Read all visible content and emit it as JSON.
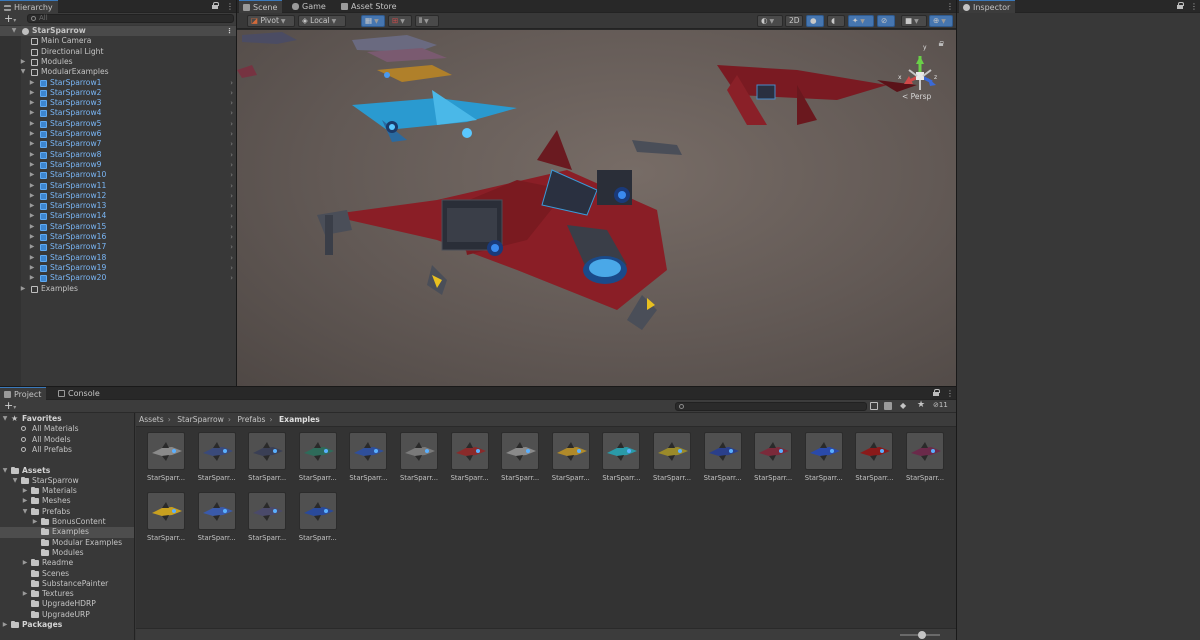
{
  "hierarchy": {
    "tab": "Hierarchy",
    "search_placeholder": "All",
    "rows": [
      {
        "label": "StarSparrow",
        "depth": 0,
        "type": "scene",
        "arrow": "▼"
      },
      {
        "label": "Main Camera",
        "depth": 1,
        "type": "object",
        "arrow": ""
      },
      {
        "label": "Directional Light",
        "depth": 1,
        "type": "object",
        "arrow": ""
      },
      {
        "label": "Modules",
        "depth": 1,
        "type": "object",
        "arrow": "▶"
      },
      {
        "label": "ModularExamples",
        "depth": 1,
        "type": "object",
        "arrow": "▼"
      },
      {
        "label": "StarSparrow1",
        "depth": 2,
        "type": "prefab",
        "arrow": "▶"
      },
      {
        "label": "StarSparrow2",
        "depth": 2,
        "type": "prefab",
        "arrow": "▶"
      },
      {
        "label": "StarSparrow3",
        "depth": 2,
        "type": "prefab",
        "arrow": "▶"
      },
      {
        "label": "StarSparrow4",
        "depth": 2,
        "type": "prefab",
        "arrow": "▶"
      },
      {
        "label": "StarSparrow5",
        "depth": 2,
        "type": "prefab",
        "arrow": "▶"
      },
      {
        "label": "StarSparrow6",
        "depth": 2,
        "type": "prefab",
        "arrow": "▶"
      },
      {
        "label": "StarSparrow7",
        "depth": 2,
        "type": "prefab",
        "arrow": "▶"
      },
      {
        "label": "StarSparrow8",
        "depth": 2,
        "type": "prefab",
        "arrow": "▶"
      },
      {
        "label": "StarSparrow9",
        "depth": 2,
        "type": "prefab",
        "arrow": "▶"
      },
      {
        "label": "StarSparrow10",
        "depth": 2,
        "type": "prefab",
        "arrow": "▶"
      },
      {
        "label": "StarSparrow11",
        "depth": 2,
        "type": "prefab",
        "arrow": "▶"
      },
      {
        "label": "StarSparrow12",
        "depth": 2,
        "type": "prefab",
        "arrow": "▶"
      },
      {
        "label": "StarSparrow13",
        "depth": 2,
        "type": "prefab",
        "arrow": "▶"
      },
      {
        "label": "StarSparrow14",
        "depth": 2,
        "type": "prefab",
        "arrow": "▶"
      },
      {
        "label": "StarSparrow15",
        "depth": 2,
        "type": "prefab",
        "arrow": "▶"
      },
      {
        "label": "StarSparrow16",
        "depth": 2,
        "type": "prefab",
        "arrow": "▶"
      },
      {
        "label": "StarSparrow17",
        "depth": 2,
        "type": "prefab",
        "arrow": "▶"
      },
      {
        "label": "StarSparrow18",
        "depth": 2,
        "type": "prefab",
        "arrow": "▶"
      },
      {
        "label": "StarSparrow19",
        "depth": 2,
        "type": "prefab",
        "arrow": "▶"
      },
      {
        "label": "StarSparrow20",
        "depth": 2,
        "type": "prefab",
        "arrow": "▶"
      },
      {
        "label": "Examples",
        "depth": 1,
        "type": "object",
        "arrow": "▶"
      }
    ]
  },
  "scene_tabs": {
    "scene": "Scene",
    "game": "Game",
    "asset_store": "Asset Store"
  },
  "scene_toolbar": {
    "pivot": "Pivot",
    "local": "Local",
    "mode_2d": "2D",
    "persp": "< Persp"
  },
  "gizmo": {
    "x": "x",
    "y": "y",
    "z": "z"
  },
  "inspector": {
    "tab": "Inspector"
  },
  "project": {
    "tab_project": "Project",
    "tab_console": "Console",
    "visible_count": "11",
    "breadcrumbs": [
      "Assets",
      "StarSparrow",
      "Prefabs",
      "Examples"
    ],
    "folders": [
      {
        "label": "Favorites",
        "depth": 0,
        "kind": "star",
        "arrow": "▼",
        "bold": true
      },
      {
        "label": "All Materials",
        "depth": 1,
        "kind": "search",
        "arrow": ""
      },
      {
        "label": "All Models",
        "depth": 1,
        "kind": "search",
        "arrow": ""
      },
      {
        "label": "All Prefabs",
        "depth": 1,
        "kind": "search",
        "arrow": ""
      },
      {
        "label": "",
        "depth": 0,
        "kind": "gap",
        "arrow": ""
      },
      {
        "label": "Assets",
        "depth": 0,
        "kind": "folder",
        "arrow": "▼",
        "bold": true
      },
      {
        "label": "StarSparrow",
        "depth": 1,
        "kind": "folder",
        "arrow": "▼"
      },
      {
        "label": "Materials",
        "depth": 2,
        "kind": "folder",
        "arrow": "▶"
      },
      {
        "label": "Meshes",
        "depth": 2,
        "kind": "folder",
        "arrow": "▶"
      },
      {
        "label": "Prefabs",
        "depth": 2,
        "kind": "folder",
        "arrow": "▼"
      },
      {
        "label": "BonusContent",
        "depth": 3,
        "kind": "folder",
        "arrow": "▶"
      },
      {
        "label": "Examples",
        "depth": 3,
        "kind": "folder",
        "arrow": "",
        "selected": true
      },
      {
        "label": "Modular Examples",
        "depth": 3,
        "kind": "folder",
        "arrow": ""
      },
      {
        "label": "Modules",
        "depth": 3,
        "kind": "folder",
        "arrow": ""
      },
      {
        "label": "Readme",
        "depth": 2,
        "kind": "folder",
        "arrow": "▶"
      },
      {
        "label": "Scenes",
        "depth": 2,
        "kind": "folder",
        "arrow": ""
      },
      {
        "label": "SubstancePainter",
        "depth": 2,
        "kind": "folder",
        "arrow": ""
      },
      {
        "label": "Textures",
        "depth": 2,
        "kind": "folder",
        "arrow": "▶"
      },
      {
        "label": "UpgradeHDRP",
        "depth": 2,
        "kind": "folder",
        "arrow": ""
      },
      {
        "label": "UpgradeURP",
        "depth": 2,
        "kind": "folder",
        "arrow": ""
      },
      {
        "label": "Packages",
        "depth": 0,
        "kind": "folder",
        "arrow": "▶",
        "bold": true
      }
    ],
    "assets": [
      {
        "name": "StarSparr...",
        "color": "#8a8a8a"
      },
      {
        "name": "StarSparr...",
        "color": "#3a4a7a"
      },
      {
        "name": "StarSparr...",
        "color": "#3a3f55"
      },
      {
        "name": "StarSparr...",
        "color": "#2e6b5a"
      },
      {
        "name": "StarSparr...",
        "color": "#2f4f9a"
      },
      {
        "name": "StarSparr...",
        "color": "#7a7a7a"
      },
      {
        "name": "StarSparr...",
        "color": "#8a2a2a"
      },
      {
        "name": "StarSparr...",
        "color": "#8a8a8a"
      },
      {
        "name": "StarSparr...",
        "color": "#b08a2a"
      },
      {
        "name": "StarSparr...",
        "color": "#2a9aa8"
      },
      {
        "name": "StarSparr...",
        "color": "#9a8a2a"
      },
      {
        "name": "StarSparr...",
        "color": "#2a3f8a"
      },
      {
        "name": "StarSparr...",
        "color": "#7a2a3a"
      },
      {
        "name": "StarSparr...",
        "color": "#2a4aaa"
      },
      {
        "name": "StarSparr...",
        "color": "#8a1a1a"
      },
      {
        "name": "StarSparr...",
        "color": "#6a2a4a"
      },
      {
        "name": "StarSparr...",
        "color": "#c8a020"
      },
      {
        "name": "StarSparr...",
        "color": "#3a5aaa"
      },
      {
        "name": "StarSparr...",
        "color": "#4a4a6a"
      },
      {
        "name": "StarSparr...",
        "color": "#2a4a9a"
      }
    ]
  }
}
